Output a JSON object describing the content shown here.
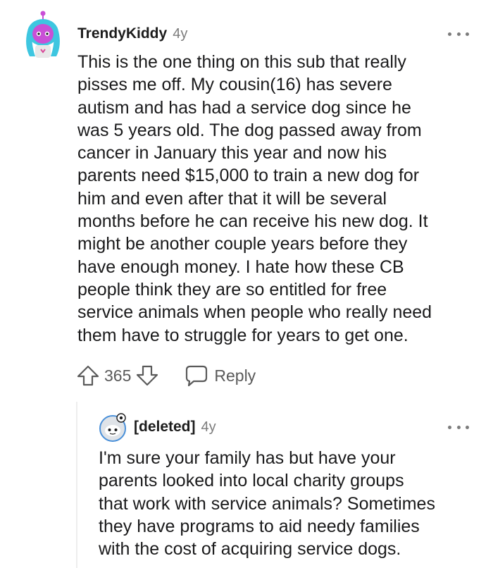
{
  "comment": {
    "username": "TrendyKiddy",
    "age": "4y",
    "body": "This is the one thing on this sub that really\npisses me off. My cousin(16) has severe\nautism and has had a service dog since he\nwas 5 years old. The dog passed away from\ncancer in January this year and now his\nparents need $15,000 to train a new dog for\nhim and even after that it will be several\nmonths before he can receive his new dog. It\nmight be another couple years before they\nhave enough money. I hate how these CB\npeople think they are so entitled for free\nservice animals when people who really need\nthem have to struggle for years to get one.",
    "score": "365",
    "reply_label": "Reply"
  },
  "reply": {
    "username": "[deleted]",
    "age": "4y",
    "body": "I'm sure your family has but have your\nparents looked into local charity groups\nthat work with service animals? Sometimes\nthey have programs to aid needy families\nwith the cost of acquiring service dogs."
  },
  "icons": {
    "upvote": "arrow-up-outline-icon",
    "downvote": "arrow-down-outline-icon",
    "reply": "speech-bubble-icon",
    "more": "more-options-icon"
  },
  "colors": {
    "text": "#1a1a1b",
    "meta": "#7c7c7c",
    "action": "#5a5a5a",
    "avatar_hair": "#3ec6e0",
    "avatar_face": "#c94fd6"
  }
}
